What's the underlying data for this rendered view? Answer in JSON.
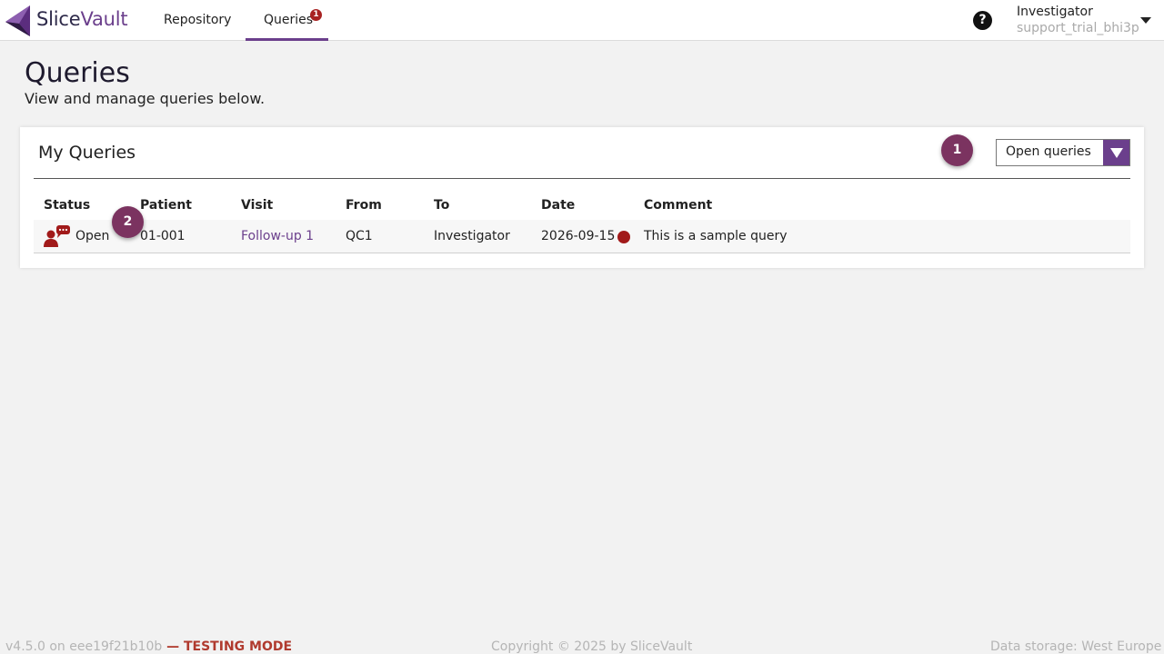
{
  "header": {
    "brand_part1": "Slice",
    "brand_part2": "Vault",
    "nav": {
      "repository": "Repository",
      "queries": "Queries",
      "queries_badge": "1"
    },
    "help_icon": "question-circle-icon",
    "help_label": "?",
    "user": {
      "role": "Investigator",
      "account": "support_trial_bhi3p"
    }
  },
  "page": {
    "title": "Queries",
    "subtitle": "View and manage queries below."
  },
  "card": {
    "title": "My Queries",
    "filter": {
      "selected": "Open queries"
    },
    "step_badges": [
      "1",
      "2"
    ],
    "columns": [
      "Status",
      "Patient",
      "Visit",
      "From",
      "To",
      "Date",
      "Comment"
    ],
    "rows": [
      {
        "status": "Open",
        "status_icon": "query-chat-icon",
        "patient": "01-001",
        "visit": "Follow-up 1",
        "from": "QC1",
        "to": "Investigator",
        "date": "2026-09-15",
        "comment": "This is a sample query"
      }
    ]
  },
  "footer": {
    "version": "v4.5.0 on eee19f21b10b",
    "mode": " — TESTING MODE",
    "copyright": "Copyright © 2025 by SliceVault",
    "storage": "Data storage: West Europe"
  },
  "colors": {
    "brand": "#6b3f8c",
    "badge": "#a82222",
    "step_badge": "#7b3360",
    "status_red": "#a11a1a"
  }
}
